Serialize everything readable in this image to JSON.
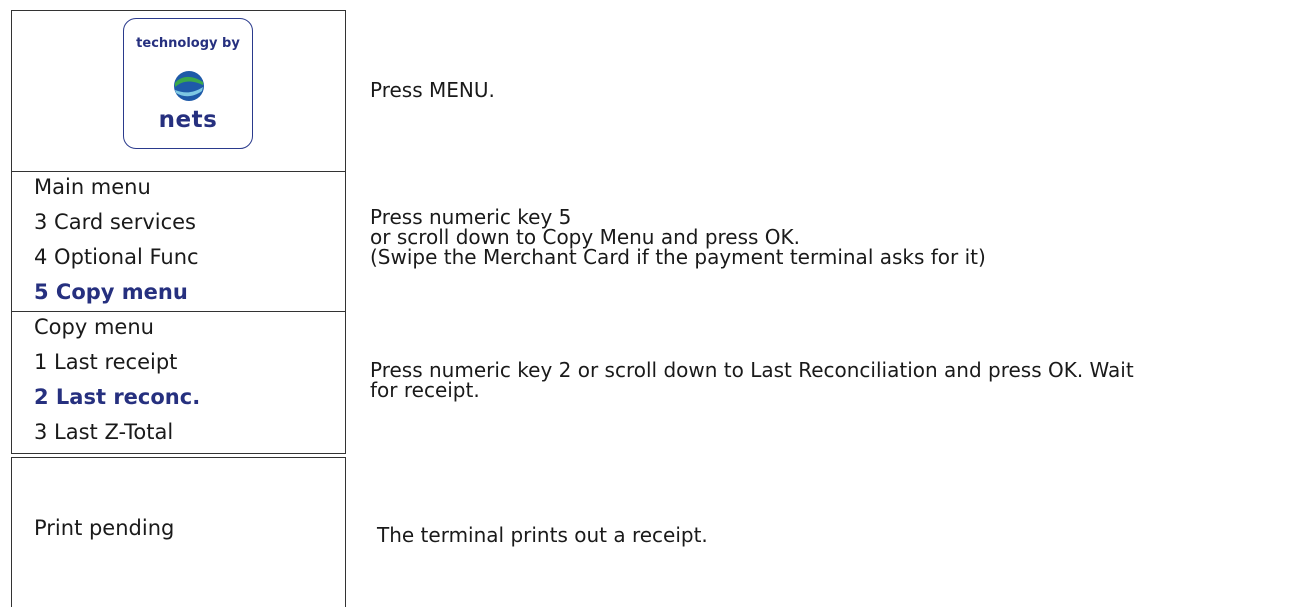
{
  "steps": [
    {
      "screen": {
        "type": "logo",
        "logo_caption": "technology by",
        "logo_word": "nets",
        "logo_colors": {
          "frame": "#2a3a8c",
          "text": "#26307f",
          "blue": "#1e5aa8",
          "green": "#3aa84a"
        }
      },
      "instruction": "Press MENU."
    },
    {
      "screen": {
        "type": "menu",
        "lines": [
          "Main menu",
          "3 Card services",
          "4 Optional Func",
          "5 Copy menu"
        ],
        "selected": "5 Copy menu"
      },
      "instruction_lines": [
        "Press numeric key 5",
        "or scroll down to Copy Menu and press OK.",
        "(Swipe the Merchant Card if the payment terminal asks for it)"
      ]
    },
    {
      "screen": {
        "type": "menu",
        "lines": [
          "Copy menu",
          "1 Last receipt",
          "2 Last reconc.",
          "3 Last Z-Total"
        ],
        "selected": "2 Last reconc."
      },
      "instruction_lines": [
        "Press numeric key 2 or scroll down to Last Reconciliation and press OK. Wait",
        "for receipt."
      ]
    },
    {
      "screen": {
        "type": "status",
        "text": "Print pending"
      },
      "instruction": "The terminal prints out a receipt."
    }
  ],
  "colors": {
    "highlight": "#26307f",
    "border": "#333333",
    "text": "#1a1a1a"
  }
}
